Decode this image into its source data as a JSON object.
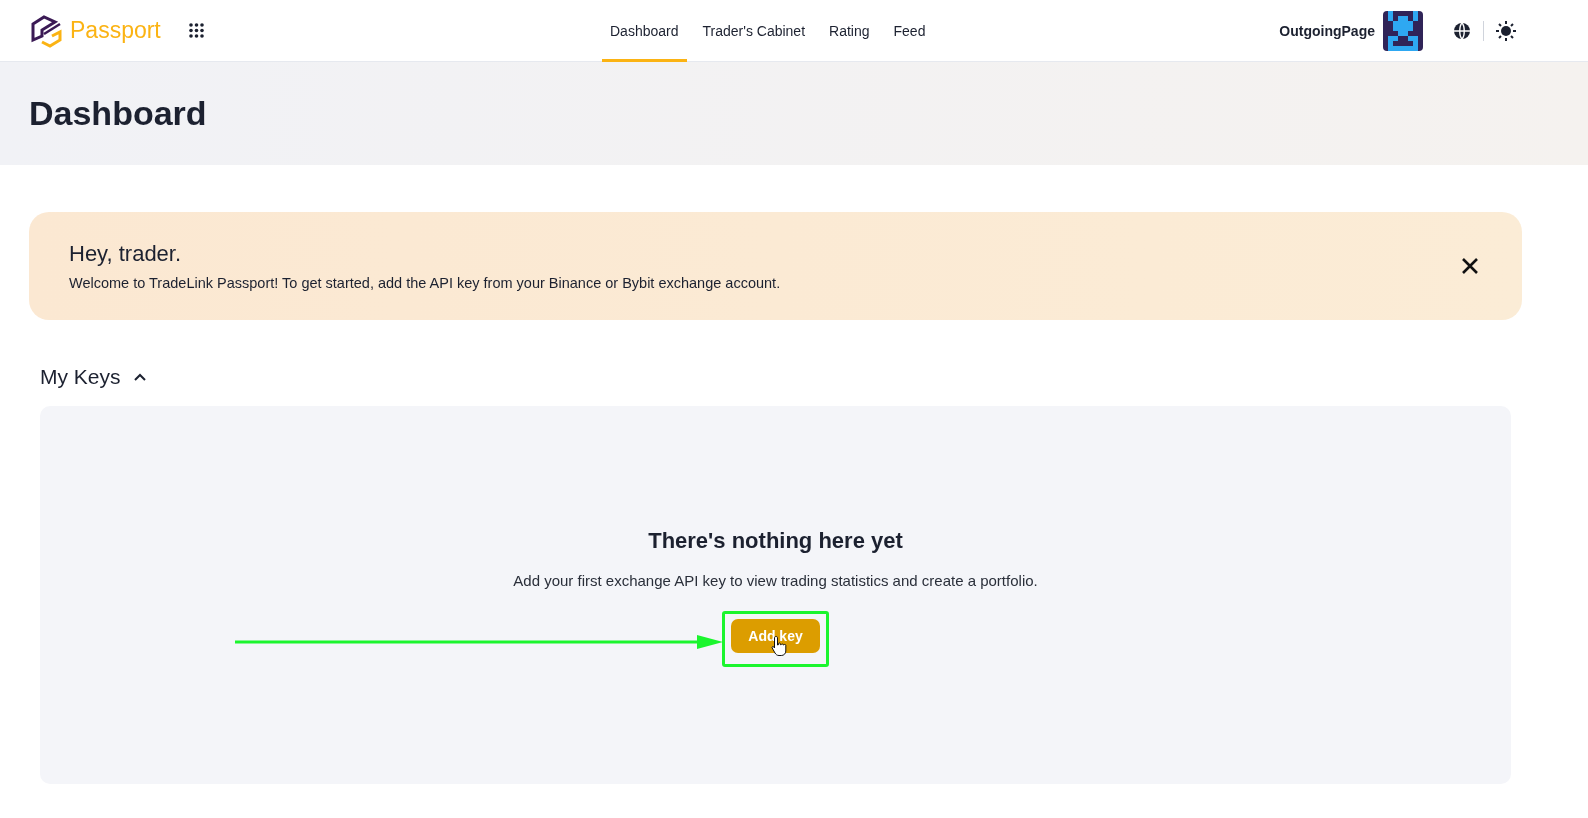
{
  "header": {
    "logo_text": "Passport",
    "nav": [
      {
        "label": "Dashboard",
        "selected": true
      },
      {
        "label": "Trader's Cabinet",
        "selected": false
      },
      {
        "label": "Rating",
        "selected": false
      },
      {
        "label": "Feed",
        "selected": false
      }
    ],
    "username": "OutgoingPage"
  },
  "page_title": "Dashboard",
  "banner": {
    "title": "Hey, trader.",
    "text": "Welcome to TradeLink Passport! To get started, add the API key from your Binance or Bybit exchange account."
  },
  "keys_section": {
    "title": "My Keys",
    "expanded": true,
    "empty_title": "There's nothing here yet",
    "empty_text": "Add your first exchange API key to view trading statistics and create a portfolio.",
    "button": "Add key"
  }
}
